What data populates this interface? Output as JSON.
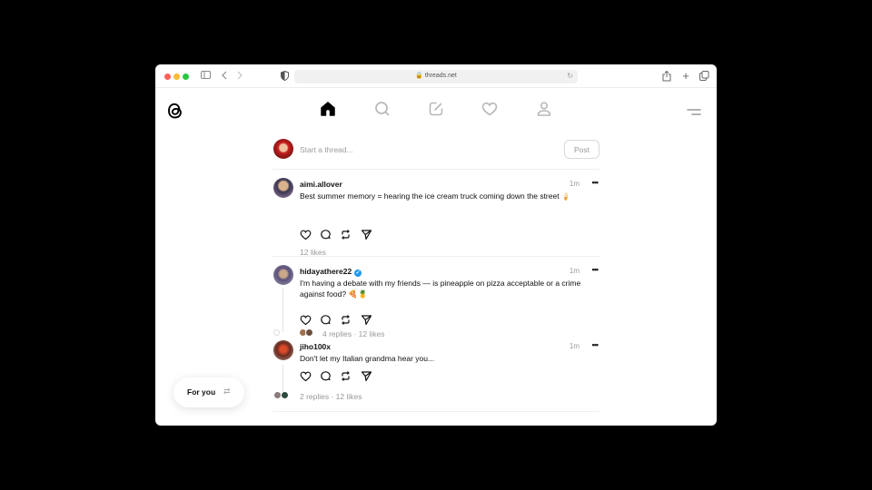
{
  "browser": {
    "url": "threads.net",
    "icons": [
      "sidebar-icon",
      "back-icon",
      "forward-icon",
      "shield-icon",
      "lock-icon",
      "reload-icon",
      "share-icon",
      "new-tab-icon",
      "tabs-overview-icon"
    ]
  },
  "nav": {
    "logo": "threads-logo",
    "items": [
      {
        "name": "home-icon",
        "active": true
      },
      {
        "name": "search-icon",
        "active": false
      },
      {
        "name": "compose-icon",
        "active": false
      },
      {
        "name": "heart-icon",
        "active": false
      },
      {
        "name": "profile-icon",
        "active": false
      }
    ],
    "menu": "menu-icon"
  },
  "composer": {
    "placeholder": "Start a thread...",
    "post_label": "Post"
  },
  "posts": [
    {
      "username": "aimi.allover",
      "verified": false,
      "time": "1m",
      "more": "•••",
      "text": "Best summer memory = hearing the ice cream truck coming down the street 🍦",
      "stats": "12 likes"
    },
    {
      "username": "hidayathere22",
      "verified": true,
      "time": "1m",
      "more": "•••",
      "text": "I'm having a debate with my friends — is pineapple on pizza acceptable or a crime against food? 🍕🍍",
      "stats": "4 replies · 12 likes"
    },
    {
      "username": "jiho100x",
      "verified": false,
      "time": "1m",
      "more": "•••",
      "text": "Don't let my Italian grandma hear you...",
      "stats": "2 replies · 12 likes"
    }
  ],
  "feed_switcher": {
    "label": "For you",
    "icon": "⇄"
  },
  "colors": {
    "verified": "#1d9bf0",
    "muted": "#999999",
    "text": "#111111"
  }
}
